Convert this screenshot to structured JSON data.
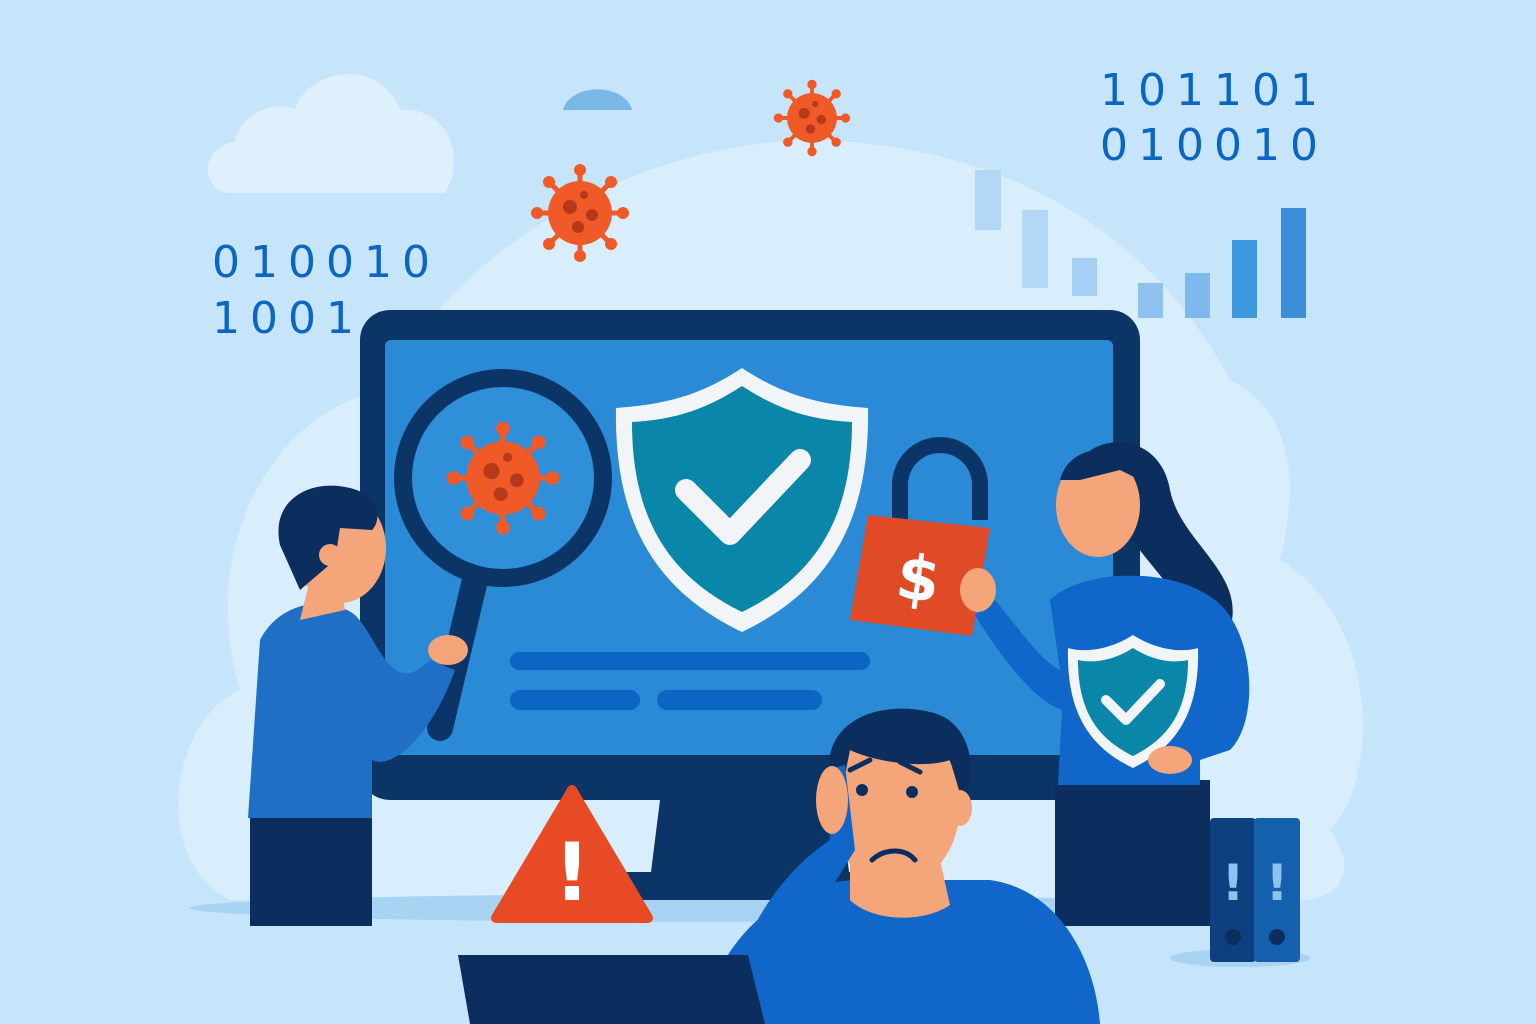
{
  "binary": {
    "top_right_line1": "101101",
    "top_right_line2": "010010",
    "left_line1": "010010",
    "left_line2": "1001"
  },
  "lock_symbol": "$",
  "warning_symbol": "!",
  "binder_symbols": [
    "!",
    "!"
  ],
  "colors": {
    "background": "#c6e4fa",
    "virus": "#f05a28",
    "monitor_frame": "#0b3566",
    "screen": "#2a8ad6",
    "shield": "#0a86a8",
    "warning": "#e84a25"
  },
  "icons": [
    "virus-icon",
    "magnifier-icon",
    "shield-check-icon",
    "unlocked-padlock-dollar-icon",
    "warning-triangle-icon",
    "bar-chart-icon",
    "binder-icon"
  ]
}
